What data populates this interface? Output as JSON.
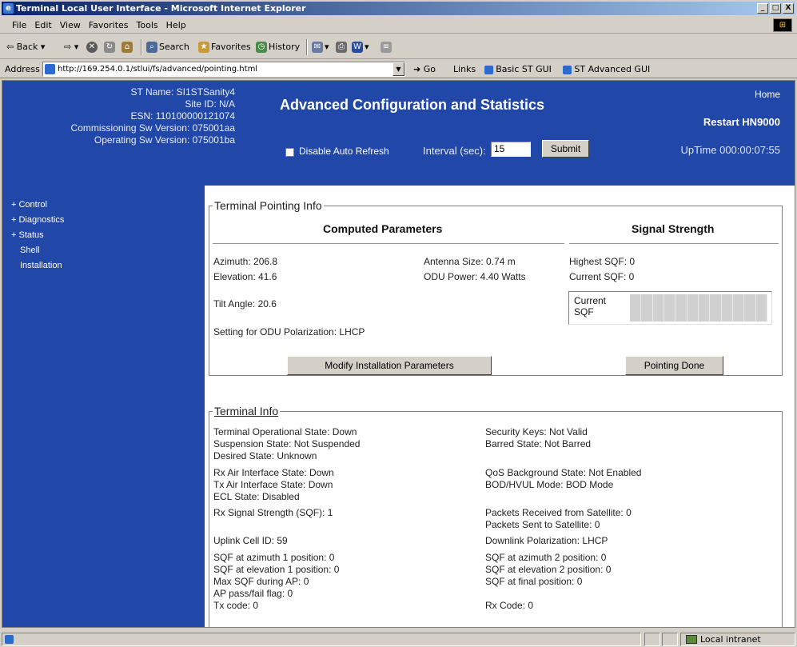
{
  "window": {
    "title": "Terminal Local User Interface - Microsoft Internet Explorer",
    "controls": {
      "minimize": "_",
      "maximize": "□",
      "close": "X"
    }
  },
  "menu": [
    "File",
    "Edit",
    "View",
    "Favorites",
    "Tools",
    "Help"
  ],
  "toolbar": {
    "back": "Back",
    "search": "Search",
    "favorites": "Favorites",
    "history": "History"
  },
  "address": {
    "label": "Address",
    "url": "http://169.254.0.1/stlui/fs/advanced/pointing.html",
    "go": "Go",
    "links_label": "Links",
    "link1": "Basic ST GUI",
    "link2": "ST Advanced GUI"
  },
  "header": {
    "st_name": "ST Name: SI1STSanity4",
    "site_id": "Site ID: N/A",
    "esn": "ESN: 110100000121074",
    "commissioning_sw": "Commissioning Sw Version: 075001aa",
    "operating_sw": "Operating Sw Version: 075001ba",
    "title": "Advanced Configuration and Statistics",
    "home": "Home",
    "restart": "Restart HN9000",
    "disable_auto_refresh": "Disable Auto Refresh",
    "interval_label": "Interval (sec):",
    "interval_value": "15",
    "submit": "Submit",
    "uptime": "UpTime 000:00:07:55"
  },
  "sidebar": {
    "items": [
      {
        "label": "+ Control",
        "sub": false
      },
      {
        "label": "+ Diagnostics",
        "sub": false
      },
      {
        "label": "+ Status",
        "sub": false
      },
      {
        "label": "Shell",
        "sub": true
      },
      {
        "label": "Installation",
        "sub": true
      }
    ]
  },
  "pointing": {
    "legend": "Terminal Pointing Info",
    "computed_header": "Computed Parameters",
    "signal_header": "Signal Strength",
    "azimuth": "Azimuth: 206.8",
    "elevation": "Elevation: 41.6",
    "tilt": "Tilt Angle: 20.6",
    "polarization": "Setting for ODU Polarization: LHCP",
    "antenna": "Antenna Size: 0.74 m",
    "odu_power": "ODU Power: 4.40 Watts",
    "highest_sqf": "Highest SQF: 0",
    "current_sqf": "Current SQF: 0",
    "sqf_meter_label_1": "Current",
    "sqf_meter_label_2": "SQF",
    "sqf_meter_level": 0,
    "modify_button": "Modify Installation Parameters",
    "done_button": "Pointing Done"
  },
  "terminal": {
    "legend": "Terminal Info",
    "left": [
      "Terminal Operational State: Down",
      "Suspension State: Not Suspended",
      "Desired State: Unknown",
      "Rx Air Interface State: Down",
      "Tx Air Interface State: Down",
      "ECL State: Disabled",
      "Rx Signal Strength (SQF): 1",
      "Uplink Cell ID: 59",
      "SQF at azimuth 1 position: 0",
      "SQF at elevation 1 position: 0",
      "Max SQF during AP: 0",
      "AP pass/fail flag: 0",
      "Tx code: 0"
    ],
    "right": [
      "Security Keys: Not Valid",
      "Barred State: Not Barred",
      "QoS Background State: Not Enabled",
      "BOD/HVUL Mode: BOD Mode",
      "Packets Received from Satellite: 0",
      "Packets Sent to Satellite: 0",
      "Downlink Polarization: LHCP",
      "SQF at azimuth 2 position: 0",
      "SQF at elevation 2 position: 0",
      "SQF at final position: 0",
      "Rx Code: 0"
    ]
  },
  "statusbar": {
    "zone": "Local intranet"
  }
}
